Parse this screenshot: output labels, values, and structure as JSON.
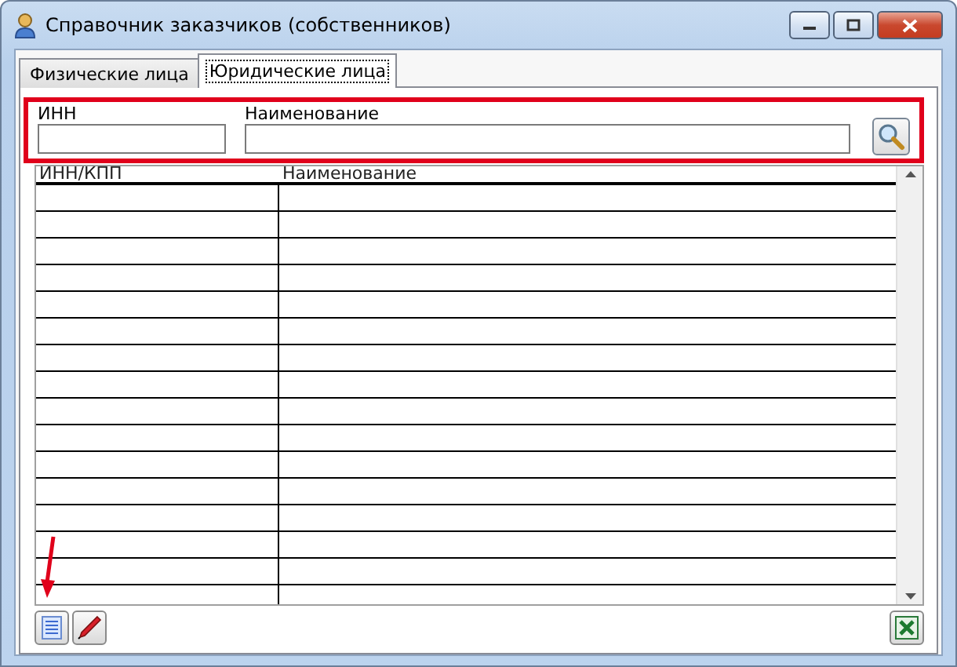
{
  "window": {
    "title": "Справочник заказчиков (собственников)"
  },
  "tabs": [
    {
      "label": "Физические лица",
      "selected": false
    },
    {
      "label": "Юридические лица",
      "selected": true
    }
  ],
  "filter": {
    "fields": [
      {
        "label": "ИНН"
      },
      {
        "label": "Наименование"
      }
    ]
  },
  "table": {
    "columns": [
      "ИНН/КПП",
      "Наименование"
    ]
  }
}
